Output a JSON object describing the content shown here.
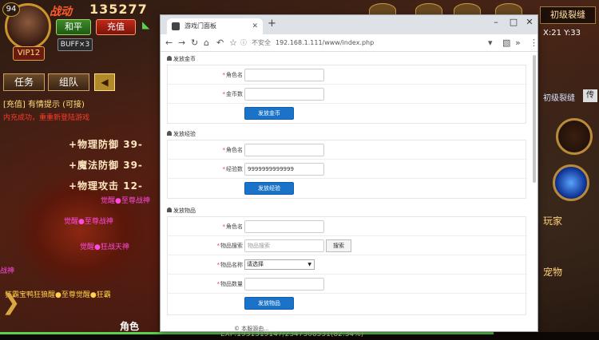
{
  "game": {
    "level": "94",
    "vip": "VIP12",
    "power_label": "战动",
    "power_value": "135277",
    "peace_button": "和平",
    "recharge_button": "充值",
    "buff": "BUFF×3",
    "tab_task": "任务",
    "tab_team": "组队",
    "hint_recharge": "[充值] 有情提示 (可接)",
    "hint_success": "内充成功，重重新登陆游戏",
    "stats": [
      "+物理防御 39-",
      "+魔法防御 39-",
      "+物理攻击 12-"
    ],
    "chat_lines": [
      "觉醒●至尊战神",
      "觉醒●至尊战神",
      "战神",
      "觉醒●狂战天神",
      "狂霸宝鸭狂狼醒●至尊觉醒●狂霸"
    ],
    "map_button": "初级裂缝",
    "coords": "X:21 Y:33",
    "right_label": "初级裂缝",
    "right_pass": "传",
    "right_bottom1": "玩家",
    "right_bottom2": "宠物",
    "role_label": "角色",
    "exp_text": "EXP:1931319147/2347308531(82.34%)",
    "exp_progress": 0.8234
  },
  "browser": {
    "tab_title": "游戏门面板",
    "address_security": "不安全",
    "address_url": "192.168.1.111/www/index.php",
    "sections": {
      "gold": {
        "title": "发放金币",
        "role_label": "角色名",
        "amount_label": "金币数",
        "role_value": "",
        "amount_value": "",
        "submit": "发放金币"
      },
      "exp": {
        "title": "发放经验",
        "role_label": "角色名",
        "amount_label": "经验数",
        "role_value": "",
        "amount_value": "9999999999999",
        "submit": "发放经验"
      },
      "item": {
        "title": "发放物品",
        "role_label": "角色名",
        "search_label": "物品搜索",
        "search_placeholder": "物品搜索",
        "search_button": "搜索",
        "name_label": "物品名称",
        "name_select": "请选择",
        "qty_label": "物品数量",
        "submit": "发放物品"
      }
    },
    "footer": "© 本服源由..."
  }
}
